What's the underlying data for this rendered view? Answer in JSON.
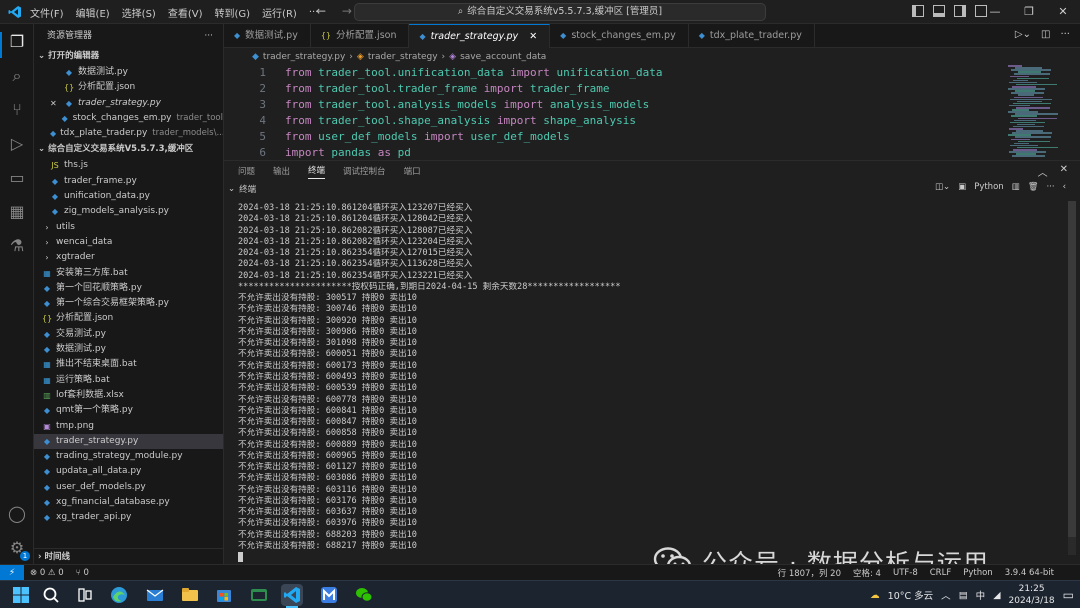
{
  "titlebar": {
    "menu": [
      "文件(F)",
      "编辑(E)",
      "选择(S)",
      "查看(V)",
      "转到(G)",
      "运行(R)",
      "···"
    ],
    "command_center": "综合自定义交易系统v5.5.7.3,缓冲区 [管理员]"
  },
  "sidebar": {
    "header": "资源管理器",
    "open_editors_label": "打开的编辑器",
    "open_editors": [
      {
        "name": "数据测试.py",
        "type": "py",
        "desc": ""
      },
      {
        "name": "分析配置.json",
        "type": "json",
        "desc": ""
      },
      {
        "name": "trader_strategy.py",
        "type": "py",
        "desc": ""
      },
      {
        "name": "stock_changes_em.py",
        "type": "py",
        "desc": "trader_tool"
      },
      {
        "name": "tdx_plate_trader.py",
        "type": "py",
        "desc": "trader_models\\..."
      }
    ],
    "workspace_label": "综合自定义交易系统V5.5.7.3,缓冲区",
    "files": [
      {
        "name": "ths.js",
        "type": "js",
        "indent": 1
      },
      {
        "name": "trader_frame.py",
        "type": "py",
        "indent": 1
      },
      {
        "name": "unification_data.py",
        "type": "py",
        "indent": 1
      },
      {
        "name": "zig_models_analysis.py",
        "type": "py",
        "indent": 1
      },
      {
        "name": "utils",
        "type": "folder",
        "indent": 0
      },
      {
        "name": "wencai_data",
        "type": "folder",
        "indent": 0
      },
      {
        "name": "xgtrader",
        "type": "folder",
        "indent": 0
      },
      {
        "name": "安装第三方库.bat",
        "type": "bat",
        "indent": 0
      },
      {
        "name": "第一个回花顺策略.py",
        "type": "py",
        "indent": 0
      },
      {
        "name": "第一个综合交易框架策略.py",
        "type": "py",
        "indent": 0
      },
      {
        "name": "分析配置.json",
        "type": "json",
        "indent": 0
      },
      {
        "name": "交易测试.py",
        "type": "py",
        "indent": 0
      },
      {
        "name": "数据测试.py",
        "type": "py",
        "indent": 0
      },
      {
        "name": "推出不结束桌面.bat",
        "type": "bat",
        "indent": 0
      },
      {
        "name": "运行策略.bat",
        "type": "bat",
        "indent": 0
      },
      {
        "name": "lof套利数据.xlsx",
        "type": "xls",
        "indent": 0
      },
      {
        "name": "qmt第一个策略.py",
        "type": "py",
        "indent": 0
      },
      {
        "name": "tmp.png",
        "type": "png",
        "indent": 0
      },
      {
        "name": "trader_strategy.py",
        "type": "py",
        "indent": 0
      },
      {
        "name": "trading_strategy_module.py",
        "type": "py",
        "indent": 0
      },
      {
        "name": "updata_all_data.py",
        "type": "py",
        "indent": 0
      },
      {
        "name": "user_def_models.py",
        "type": "py",
        "indent": 0
      },
      {
        "name": "xg_financial_database.py",
        "type": "py",
        "indent": 0
      },
      {
        "name": "xg_trader_api.py",
        "type": "py",
        "indent": 0
      }
    ],
    "timeline_label": "时间线"
  },
  "tabs": [
    {
      "label": "数据测试.py",
      "type": "py",
      "active": false
    },
    {
      "label": "分析配置.json",
      "type": "json",
      "active": false
    },
    {
      "label": "trader_strategy.py",
      "type": "py",
      "active": true
    },
    {
      "label": "stock_changes_em.py",
      "type": "py",
      "active": false
    },
    {
      "label": "tdx_plate_trader.py",
      "type": "py",
      "active": false
    }
  ],
  "breadcrumb": [
    "trader_strategy.py",
    "trader_strategy",
    "save_account_data"
  ],
  "editor": {
    "lines": [
      {
        "n": "1",
        "a": "from",
        "b": " trader_tool.unification_data ",
        "c": "import",
        "d": " unification_data"
      },
      {
        "n": "2",
        "a": "from",
        "b": " trader_tool.trader_frame ",
        "c": "import",
        "d": " trader_frame"
      },
      {
        "n": "3",
        "a": "from",
        "b": " trader_tool.analysis_models ",
        "c": "import",
        "d": " analysis_models"
      },
      {
        "n": "4",
        "a": "from",
        "b": " trader_tool.shape_analysis ",
        "c": "import",
        "d": " shape_analysis"
      },
      {
        "n": "5",
        "a": "from",
        "b": " user_def_models ",
        "c": "import",
        "d": " user_def_models"
      },
      {
        "n": "6",
        "a": "import",
        "b": " pandas ",
        "c": "as",
        "d": " pd"
      }
    ]
  },
  "panel": {
    "tabs": [
      "问题",
      "输出",
      "终端",
      "调试控制台",
      "端口"
    ],
    "active_tab": "终端",
    "section_label": "终端",
    "shell": "Python",
    "terminal_lines": [
      "2024-03-18 21:25:10.861204循环买入123207已经买入",
      "2024-03-18 21:25:10.861204循环买入128042已经买入",
      "2024-03-18 21:25:10.862082循环买入128087已经买入",
      "2024-03-18 21:25:10.862082循环买入123204已经买入",
      "2024-03-18 21:25:10.862354循环买入127015已经买入",
      "2024-03-18 21:25:10.862354循环买入113628已经买入",
      "2024-03-18 21:25:10.862354循环买入123221已经买入",
      "**********************授权码正确,到期日2024-04-15 剩余天数28******************",
      "不允许卖出没有持股: 300517 持股0 卖出10",
      "不允许卖出没有持股: 300746 持股0 卖出10",
      "不允许卖出没有持股: 300920 持股0 卖出10",
      "不允许卖出没有持股: 300986 持股0 卖出10",
      "不允许卖出没有持股: 301098 持股0 卖出10",
      "不允许卖出没有持股: 600051 持股0 卖出10",
      "不允许卖出没有持股: 600173 持股0 卖出10",
      "不允许卖出没有持股: 600493 持股0 卖出10",
      "不允许卖出没有持股: 600539 持股0 卖出10",
      "不允许卖出没有持股: 600778 持股0 卖出10",
      "不允许卖出没有持股: 600841 持股0 卖出10",
      "不允许卖出没有持股: 600847 持股0 卖出10",
      "不允许卖出没有持股: 600858 持股0 卖出10",
      "不允许卖出没有持股: 600889 持股0 卖出10",
      "不允许卖出没有持股: 600965 持股0 卖出10",
      "不允许卖出没有持股: 601127 持股0 卖出10",
      "不允许卖出没有持股: 603086 持股0 卖出10",
      "不允许卖出没有持股: 603116 持股0 卖出10",
      "不允许卖出没有持股: 603176 持股0 卖出10",
      "不允许卖出没有持股: 603637 持股0 卖出10",
      "不允许卖出没有持股: 603976 持股0 卖出10",
      "不允许卖出没有持股: 688203 持股0 卖出10",
      "不允许卖出没有持股: 688217 持股0 卖出10"
    ]
  },
  "watermark": {
    "text": "公众号 · 数据分析与运用"
  },
  "status": {
    "errors": "⊗ 0 ⚠ 0",
    "ports": "⑂ 0",
    "position": "行 1807，列 20",
    "spaces": "空格: 4",
    "encoding": "UTF-8",
    "eol": "CRLF",
    "language": "Python",
    "interpreter": "3.9.4 64-bit"
  },
  "taskbar": {
    "weather": "10°C 多云",
    "ime": "中",
    "time": "21:25",
    "date": "2024/3/18"
  },
  "colors": {
    "accent": "#0078d4",
    "keyword": "#c586c0",
    "module": "#4ec9b0"
  }
}
